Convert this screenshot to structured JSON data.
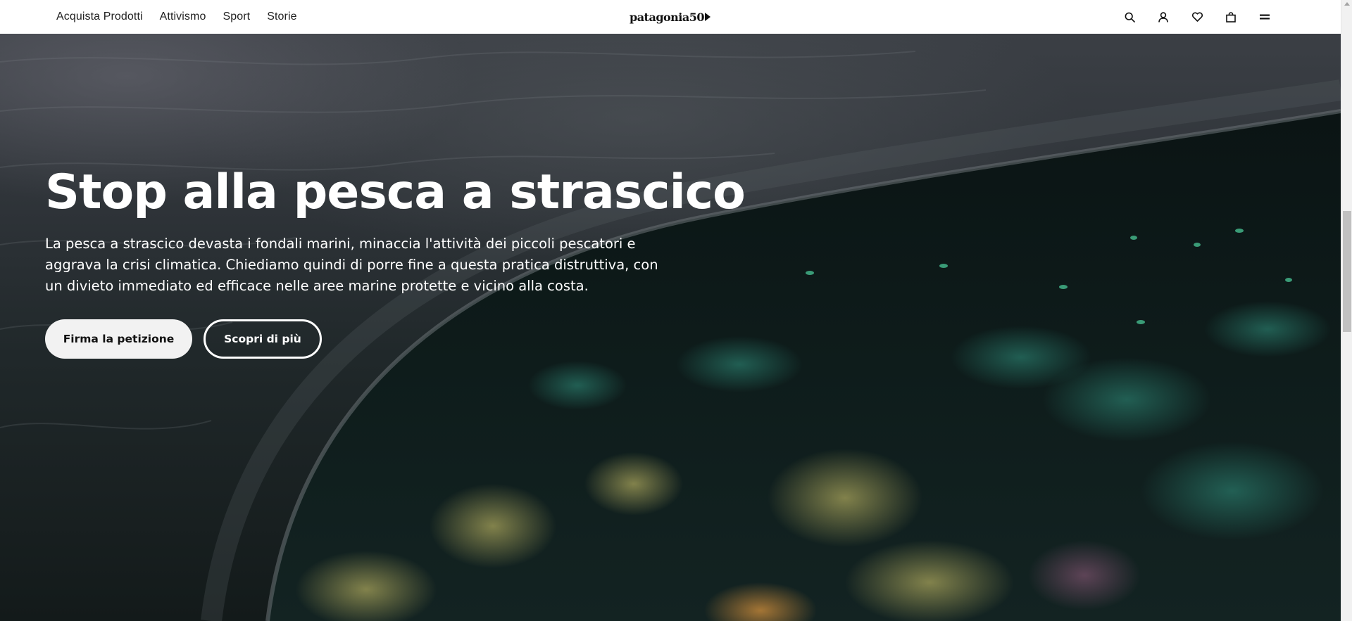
{
  "header": {
    "nav": [
      {
        "label": "Acquista Prodotti"
      },
      {
        "label": "Attivismo"
      },
      {
        "label": "Sport"
      },
      {
        "label": "Storie"
      }
    ],
    "logo_text": "patagonia",
    "logo_suffix": "50",
    "icons": [
      "search-icon",
      "account-icon",
      "heart-icon",
      "bag-icon",
      "menu-icon"
    ]
  },
  "hero": {
    "title": "Stop alla pesca a strascico",
    "description": "La pesca a strascico devasta i fondali marini, minaccia l'attività dei piccoli pescatori e aggrava la crisi climatica. Chiediamo quindi di porre fine a questa pratica distruttiva, con un divieto immediato ed efficace nelle aree marine protette e vicino alla costa.",
    "primary_button": "Firma la petizione",
    "secondary_button": "Scopri di più"
  },
  "colors": {
    "header_bg": "#ffffff",
    "text_dark": "#222222",
    "hero_text": "#ffffff",
    "button_light": "#f2f2f2"
  }
}
